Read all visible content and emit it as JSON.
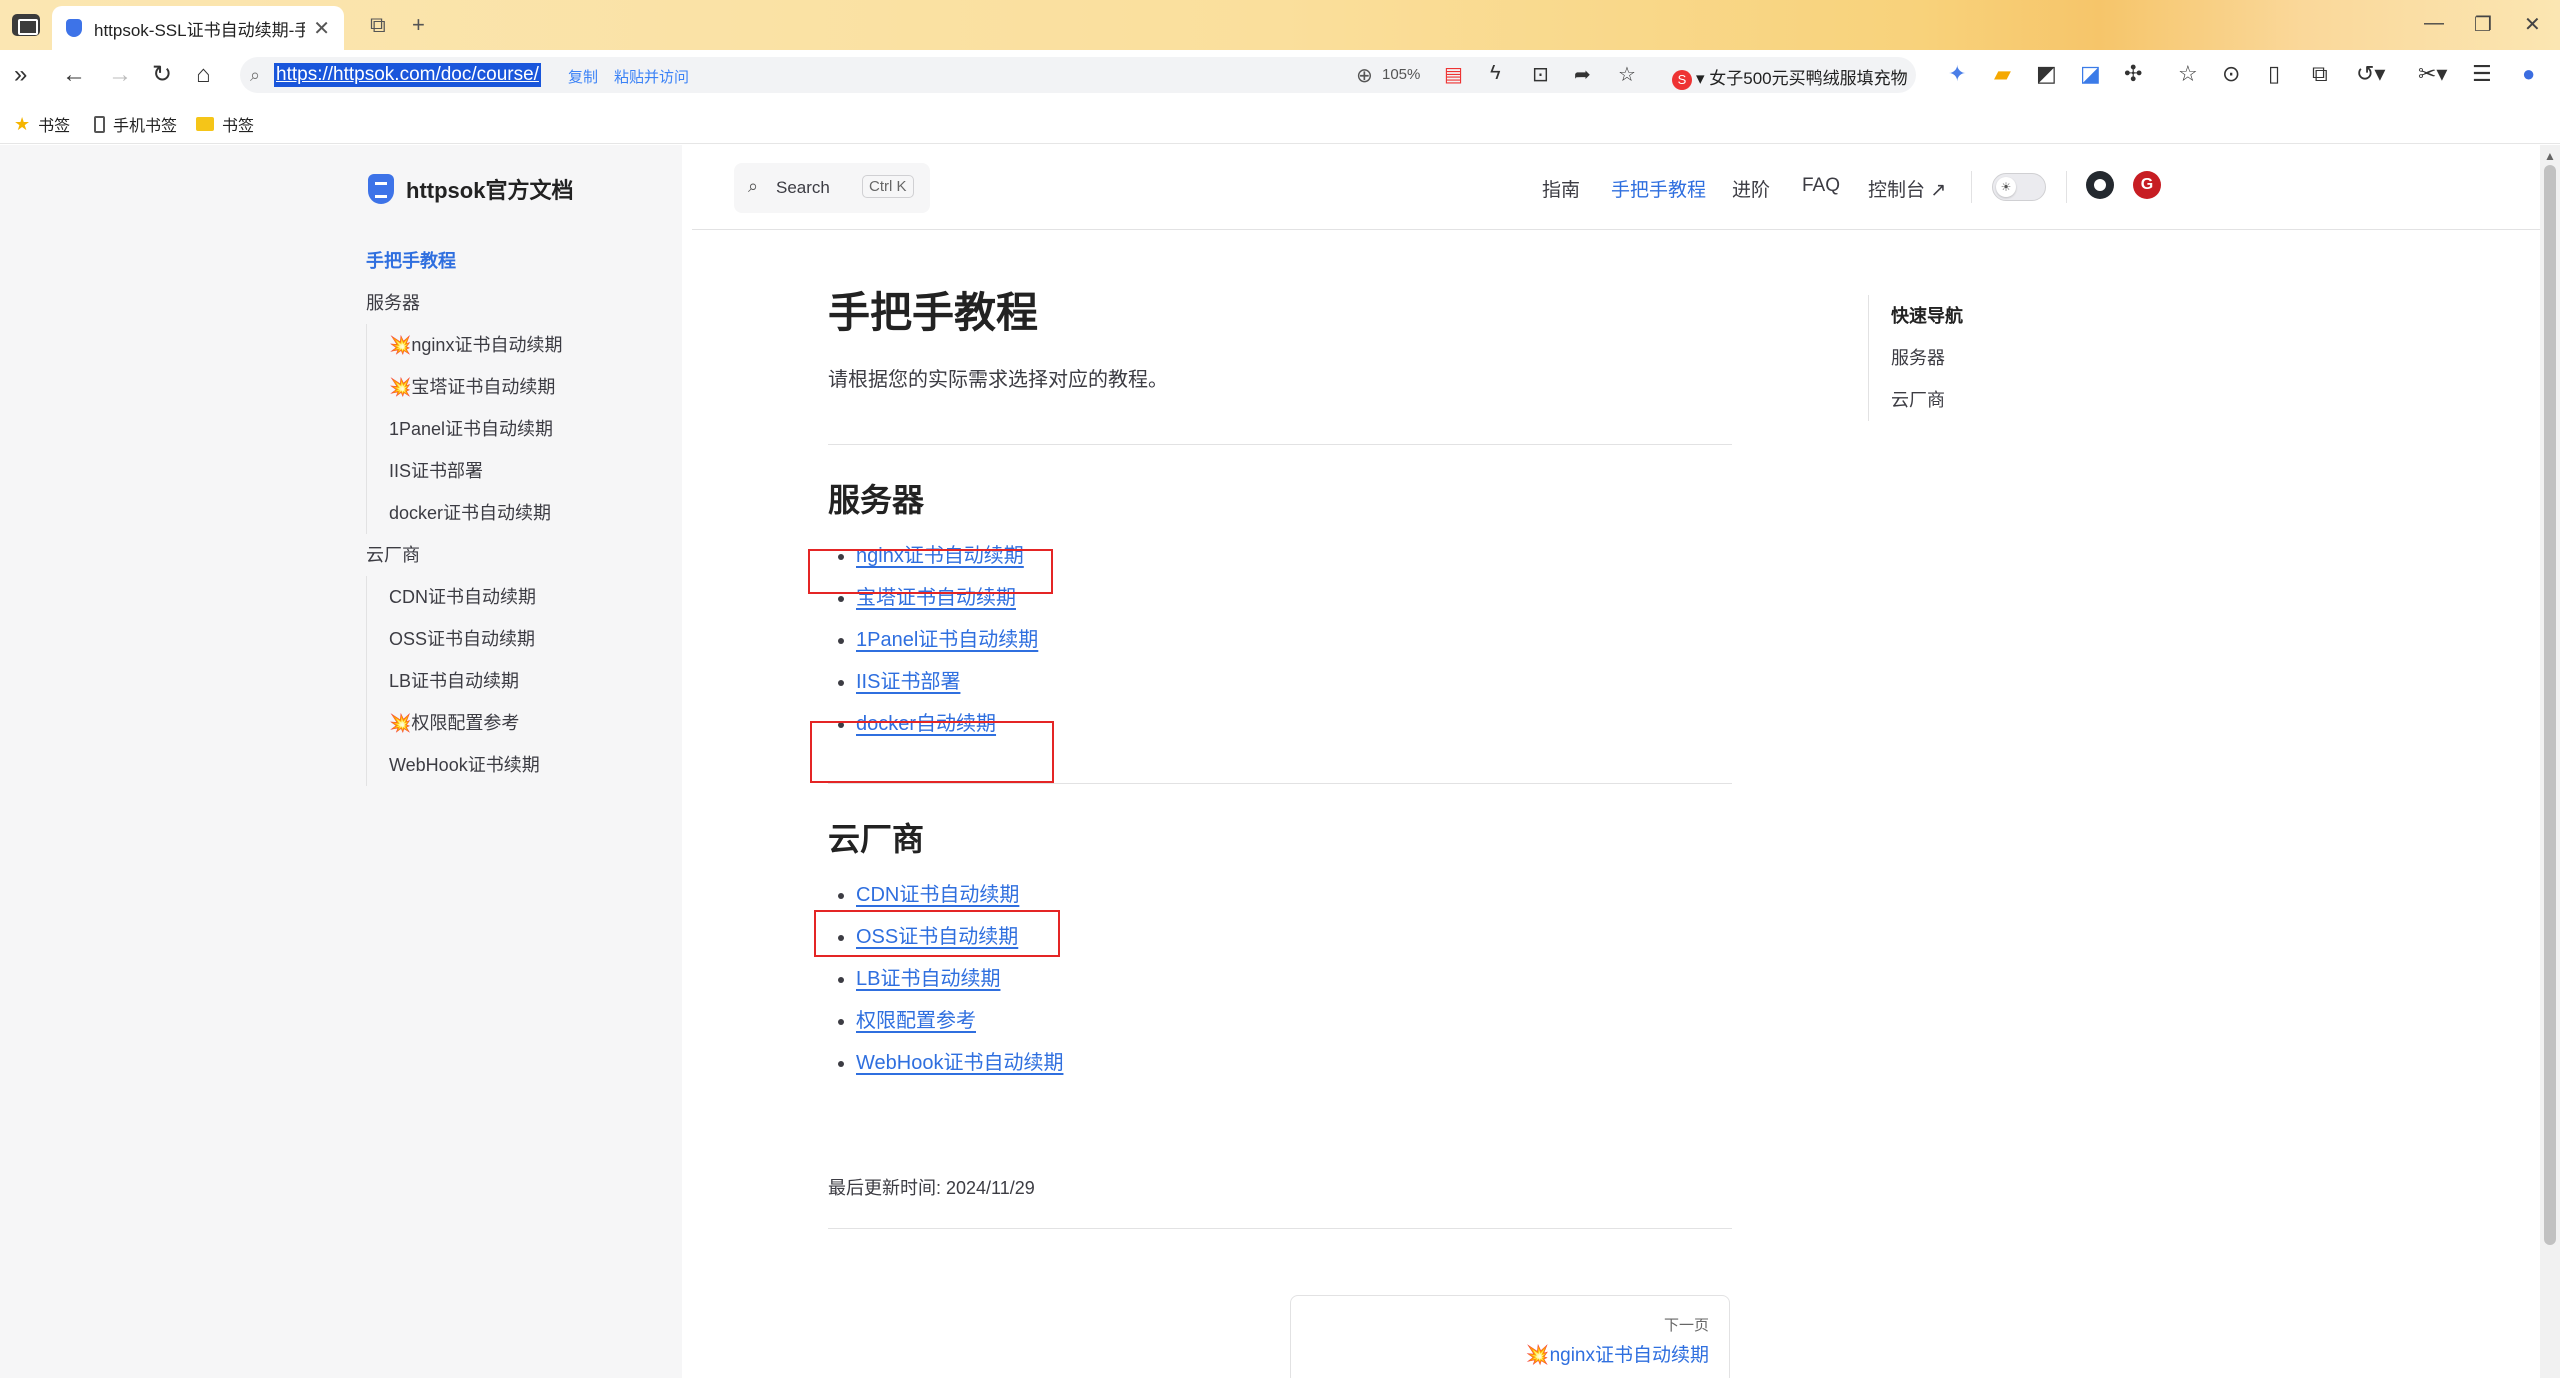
{
  "browser": {
    "tab_title": "httpsok-SSL证书自动续期-手把",
    "url": "https://httpsok.com/doc/course/",
    "url_copy": "复制",
    "url_paste_visit": "粘贴并访问",
    "zoom": "105%",
    "promo_text": "女子500元买鸭绒服填充物",
    "promo_badge": "S"
  },
  "bookmarks": [
    {
      "label": "书签"
    },
    {
      "label": "手机书签"
    },
    {
      "label": "书签"
    }
  ],
  "site": {
    "logo_text": "httpsok官方文档",
    "search": {
      "label": "Search",
      "shortcut": "Ctrl K"
    },
    "nav": [
      {
        "label": "指南"
      },
      {
        "label": "手把手教程"
      },
      {
        "label": "进阶"
      },
      {
        "label": "FAQ"
      },
      {
        "label": "控制台 ↗"
      }
    ],
    "gitee_badge": "G"
  },
  "sidebar": {
    "top": "手把手教程",
    "groups": [
      {
        "title": "服务器",
        "items": [
          "💥nginx证书自动续期",
          "💥宝塔证书自动续期",
          "1Panel证书自动续期",
          "IIS证书部署",
          "docker证书自动续期"
        ]
      },
      {
        "title": "云厂商",
        "items": [
          "CDN证书自动续期",
          "OSS证书自动续期",
          "LB证书自动续期",
          "💥权限配置参考",
          "WebHook证书续期"
        ]
      }
    ]
  },
  "main": {
    "title": "手把手教程",
    "description": "请根据您的实际需求选择对应的教程。",
    "sections": [
      {
        "title": "服务器",
        "links": [
          "nginx证书自动续期",
          "宝塔证书自动续期",
          "1Panel证书自动续期",
          "IIS证书部署",
          "docker自动续期"
        ]
      },
      {
        "title": "云厂商",
        "links": [
          "CDN证书自动续期",
          "OSS证书自动续期",
          "LB证书自动续期",
          "权限配置参考",
          "WebHook证书自动续期"
        ]
      }
    ],
    "last_updated_label": "最后更新时间: ",
    "last_updated_value": "2024/11/29",
    "next": {
      "label": "下一页",
      "title": "💥nginx证书自动续期"
    }
  },
  "outline": {
    "title": "快速导航",
    "items": [
      "服务器",
      "云厂商"
    ]
  },
  "colors": {
    "accent": "#2f6fdf",
    "highlight_box": "#e42525",
    "tabbar": "#fadf9c"
  }
}
